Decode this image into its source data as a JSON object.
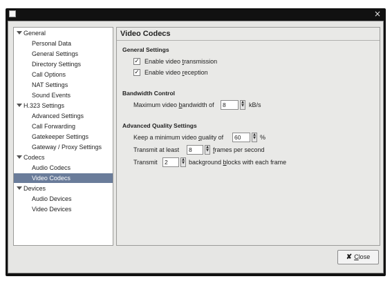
{
  "window": {
    "close_glyph": "×"
  },
  "sidebar": {
    "items": [
      {
        "label": "General",
        "level": 0,
        "expanded": true
      },
      {
        "label": "Personal Data",
        "level": 1
      },
      {
        "label": "General Settings",
        "level": 1
      },
      {
        "label": "Directory Settings",
        "level": 1
      },
      {
        "label": "Call Options",
        "level": 1
      },
      {
        "label": "NAT Settings",
        "level": 1
      },
      {
        "label": "Sound Events",
        "level": 1
      },
      {
        "label": "H.323 Settings",
        "level": 0,
        "expanded": true
      },
      {
        "label": "Advanced Settings",
        "level": 1
      },
      {
        "label": "Call Forwarding",
        "level": 1
      },
      {
        "label": "Gatekeeper Settings",
        "level": 1
      },
      {
        "label": "Gateway / Proxy Settings",
        "level": 1
      },
      {
        "label": "Codecs",
        "level": 0,
        "expanded": true
      },
      {
        "label": "Audio Codecs",
        "level": 1
      },
      {
        "label": "Video Codecs",
        "level": 1,
        "selected": true
      },
      {
        "label": "Devices",
        "level": 0,
        "expanded": true
      },
      {
        "label": "Audio Devices",
        "level": 1
      },
      {
        "label": "Video Devices",
        "level": 1
      }
    ]
  },
  "panel": {
    "title": "Video Codecs",
    "general": {
      "heading": "General Settings",
      "enable_tx_pre": "Enable video ",
      "enable_tx_ul": "t",
      "enable_tx_post": "ransmission",
      "enable_tx_checked": true,
      "enable_rx_pre": "Enable video ",
      "enable_rx_ul": "r",
      "enable_rx_post": "eception",
      "enable_rx_checked": true,
      "check_glyph": "✓"
    },
    "bandwidth": {
      "heading": "Bandwidth Control",
      "label_pre": "Maximum video ",
      "label_ul": "b",
      "label_post": "andwidth of",
      "value": "8",
      "unit": "kB/s"
    },
    "quality": {
      "heading": "Advanced Quality Settings",
      "min_quality_pre": "Keep a minimum video ",
      "min_quality_ul": "q",
      "min_quality_post": "uality of",
      "min_quality_value": "60",
      "min_quality_unit": "%",
      "transmit_at_least": "Transmit at least",
      "fps_value": "8",
      "fps_ul": "f",
      "fps_post": "rames per second",
      "transmit": "Transmit",
      "blocks_value": "2",
      "blocks_pre": "background ",
      "blocks_ul": "b",
      "blocks_post": "locks with each frame"
    }
  },
  "footer": {
    "close_icon": "✘",
    "close_ul": "C",
    "close_post": "lose"
  },
  "icons": {
    "spin_up": "▲",
    "spin_down": "▼"
  }
}
